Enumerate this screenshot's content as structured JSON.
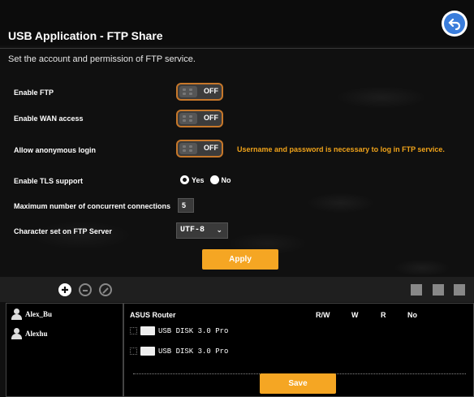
{
  "header": {
    "title": "USB Application - FTP Share",
    "description": "Set the account and permission of FTP service."
  },
  "settings": {
    "enable_ftp": {
      "label": "Enable FTP",
      "state": "OFF"
    },
    "enable_wan": {
      "label": "Enable WAN access",
      "state": "OFF"
    },
    "anonymous_login": {
      "label": "Allow anonymous login",
      "state": "OFF",
      "note": "Username and password is necessary to log in FTP service."
    },
    "tls": {
      "label": "Enable TLS support",
      "yes": "Yes",
      "no": "No",
      "selected": "Yes"
    },
    "max_connections": {
      "label": "Maximum number of concurrent connections",
      "value": "5"
    },
    "charset": {
      "label": "Character set on FTP Server",
      "value": "UTF-8"
    },
    "apply_label": "Apply"
  },
  "accounts": [
    {
      "name": "Alex_Bu"
    },
    {
      "name": "Alexhu"
    }
  ],
  "permissions": {
    "device": "ASUS Router",
    "columns": [
      "R/W",
      "W",
      "R",
      "No"
    ],
    "disks": [
      "USB DISK 3.0 Pro",
      "USB DISK 3.0 Pro"
    ]
  },
  "save_label": "Save",
  "icons": {
    "back": "back-arrow-icon",
    "add": "add-circle-icon",
    "remove": "remove-circle-icon",
    "edit": "edit-circle-icon",
    "colors": {
      "accent": "#f5a623",
      "toggle_border": "#c6772a",
      "warning": "#f0a31a"
    }
  }
}
